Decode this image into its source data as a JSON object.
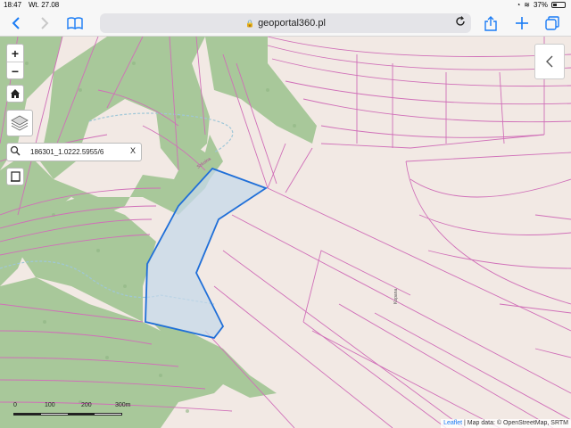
{
  "status_bar": {
    "time": "18:47",
    "date": "Wt. 27.08",
    "battery": "37%",
    "battery_level": 0.37,
    "wifi_icon": "wifi-icon",
    "alarm_icon": "alarm-icon"
  },
  "browser": {
    "url": "geoportal360.pl",
    "back_icon": "chevron-left-icon",
    "forward_icon": "chevron-right-icon",
    "bookmarks_icon": "book-icon",
    "reload_icon": "reload-icon",
    "share_icon": "share-icon",
    "add_tab_icon": "plus-icon",
    "tabs_icon": "tabs-icon"
  },
  "map_controls": {
    "zoom_in": "+",
    "zoom_out": "−",
    "home_icon": "home-icon",
    "layers_icon": "layers-icon",
    "search_value": "186301_1.0222.5955/6",
    "search_clear": "X",
    "print_icon": "print-icon",
    "panel_toggle_icon": "chevron-left-icon"
  },
  "scale_bar": {
    "labels": [
      "0",
      "100",
      "200",
      "300m"
    ]
  },
  "attribution": {
    "leaflet": "Leaflet",
    "text": " | Map data: © OpenStreetMap, SRTM"
  },
  "colors": {
    "map_background": "#f2e9e4",
    "forest": "#a8c89a",
    "parcel_lines": "#d06fb8",
    "selected_parcel_fill": "#c5d8ea",
    "selected_parcel_stroke": "#1f6fd8",
    "link_blue": "#1a7cf5"
  }
}
